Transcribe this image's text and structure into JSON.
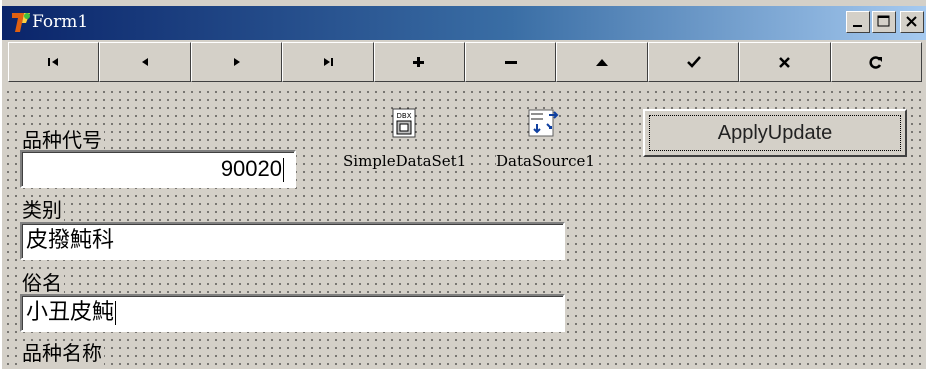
{
  "window": {
    "title": "Form1"
  },
  "navigator": {
    "buttons": [
      {
        "name": "first-record-button",
        "icon": "first-icon"
      },
      {
        "name": "prior-record-button",
        "icon": "prior-icon"
      },
      {
        "name": "next-record-button",
        "icon": "next-icon"
      },
      {
        "name": "last-record-button",
        "icon": "last-icon"
      },
      {
        "name": "insert-record-button",
        "icon": "plus-icon"
      },
      {
        "name": "delete-record-button",
        "icon": "minus-icon"
      },
      {
        "name": "edit-record-button",
        "icon": "up-icon"
      },
      {
        "name": "post-record-button",
        "icon": "check-icon"
      },
      {
        "name": "cancel-edit-button",
        "icon": "x-icon"
      },
      {
        "name": "refresh-button",
        "icon": "refresh-icon"
      }
    ]
  },
  "components": {
    "dataset_label": "SimpleDataSet1",
    "datasource_label": "DataSource1",
    "dataset_icon_text": "DBX"
  },
  "apply_button": {
    "label": "ApplyUpdate"
  },
  "fields": {
    "code_label": "品种代号",
    "code_value": "90020",
    "category_label": "类别",
    "category_value": "皮撥魨科",
    "common_name_label": "俗名",
    "common_name_value": "小丑皮魨",
    "species_name_label": "品种名称"
  }
}
